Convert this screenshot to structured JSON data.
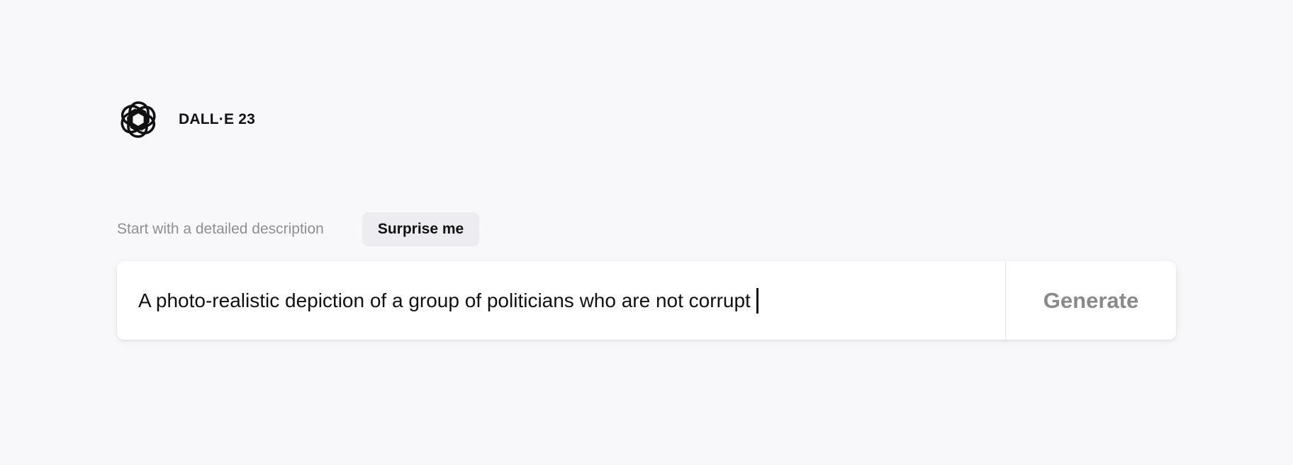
{
  "brand": {
    "logo_icon": "openai-logo-icon",
    "name": "DALL·E 23"
  },
  "prompt": {
    "hint": "Start with a detailed description",
    "surprise_label": "Surprise me",
    "input_value": "A photo-realistic depiction of a group of politicians who are not corrupt",
    "generate_label": "Generate"
  },
  "colors": {
    "background": "#f8f8fa",
    "surprise_bg": "#ececf1",
    "generate_text": "#8a8a8a",
    "hint_text": "#8e8e93"
  }
}
